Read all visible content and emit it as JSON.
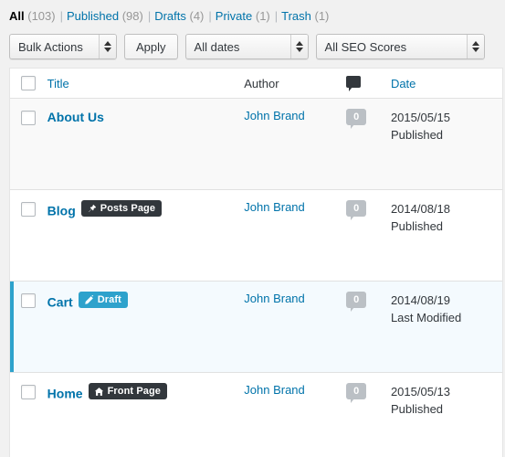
{
  "filters": {
    "items": [
      {
        "label": "All",
        "count": "(103)",
        "current": true
      },
      {
        "label": "Published",
        "count": "(98)",
        "current": false
      },
      {
        "label": "Drafts",
        "count": "(4)",
        "current": false
      },
      {
        "label": "Private",
        "count": "(1)",
        "current": false
      },
      {
        "label": "Trash",
        "count": "(1)",
        "current": false
      }
    ],
    "separator": "|"
  },
  "toolbar": {
    "bulk_actions_label": "Bulk Actions",
    "apply_label": "Apply",
    "dates_label": "All dates",
    "seo_label": "All SEO Scores"
  },
  "table": {
    "headers": {
      "title": "Title",
      "author": "Author",
      "comments_icon": "comment-bubble-icon",
      "date": "Date"
    },
    "rows": [
      {
        "title": "About Us",
        "badge": null,
        "badge_icon": null,
        "author": "John Brand",
        "comments": "0",
        "date": "2015/05/15",
        "status": "Published",
        "zebra": "alt",
        "current": false
      },
      {
        "title": "Blog",
        "badge": "Posts Page",
        "badge_icon": "pin-icon",
        "badge_style": "dark",
        "author": "John Brand",
        "comments": "0",
        "date": "2014/08/18",
        "status": "Published",
        "zebra": "",
        "current": false
      },
      {
        "title": "Cart",
        "badge": "Draft",
        "badge_icon": "pencil-icon",
        "badge_style": "blue",
        "author": "John Brand",
        "comments": "0",
        "date": "2014/08/19",
        "status": "Last Modified",
        "zebra": "",
        "current": true
      },
      {
        "title": "Home",
        "badge": "Front Page",
        "badge_icon": "home-icon",
        "badge_style": "dark",
        "author": "John Brand",
        "comments": "0",
        "date": "2015/05/13",
        "status": "Published",
        "zebra": "",
        "current": false
      }
    ]
  },
  "colors": {
    "link": "#0073aa",
    "accent": "#2ea2cc",
    "badge_dark": "#32373c",
    "count_bubble": "#bbc0c5",
    "current_row_bg": "#f4fafe"
  }
}
